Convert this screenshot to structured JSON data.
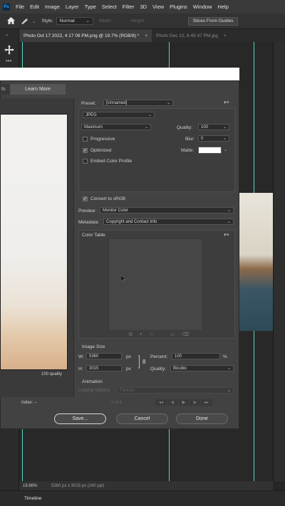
{
  "menubar": {
    "logo": "Ps",
    "items": [
      "File",
      "Edit",
      "Image",
      "Layer",
      "Type",
      "Select",
      "Filter",
      "3D",
      "View",
      "Plugins",
      "Window",
      "Help"
    ]
  },
  "options": {
    "style_label": "Style:",
    "style_value": "Normal",
    "width_label": "Width:",
    "height_label": "Height:",
    "slices_button": "Slices From Guides"
  },
  "tabs": [
    {
      "label": "Photo Oct 17 2022, 4 17 08 PM.png @ 19.7% (RGB/8) *",
      "close": "×"
    },
    {
      "label": "Photo Dec 12, 6 45 47 PM.jpg",
      "close": "×"
    }
  ],
  "dialog": {
    "learn_tab_partial": "ts",
    "learn_more": "Learn More",
    "preview_quality": "100 quality",
    "index_label": "Index: --",
    "preset_label": "Preset:",
    "preset_value": "[Unnamed]",
    "format": "JPEG",
    "compression": "Maximum",
    "quality_label": "Quality:",
    "quality_value": "100",
    "progressive": "Progressive",
    "blur_label": "Blur:",
    "blur_value": "0",
    "optimized": "Optimized",
    "matte_label": "Matte:",
    "embed_profile": "Embed Color Profile",
    "convert_srgb": "Convert to sRGB",
    "preview_label": "Preview:",
    "preview_value": "Monitor Color",
    "metadata_label": "Metadata:",
    "metadata_value": "Copyright and Contact Info",
    "color_table": "Color Table",
    "image_size": "Image Size",
    "w_label": "W:",
    "w_value": "5360",
    "h_label": "H:",
    "h_value": "3015",
    "px": "px",
    "percent_label": "Percent:",
    "percent_value": "100",
    "percent_sign": "%",
    "quality2_label": "Quality:",
    "quality2_value": "Bicubic",
    "animation": "Animation",
    "looping_label": "Looping Options:",
    "looping_value": "Forever",
    "frame_count": "1 of 1",
    "save_button": "Save...",
    "cancel_button": "Cancel",
    "done_button": "Done"
  },
  "status": {
    "zoom": "19.66%",
    "dims": "5360 px x 3015 px (240 ppi)"
  },
  "timeline": "Timeline"
}
